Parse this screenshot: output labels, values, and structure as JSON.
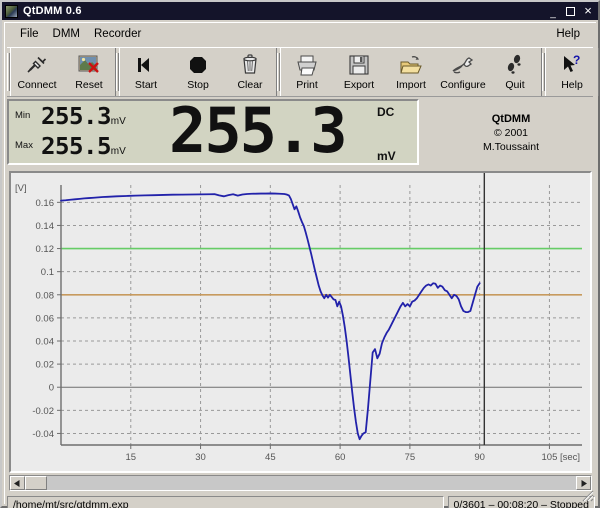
{
  "window": {
    "title": "QtDMM 0.6",
    "icon": "app-icon",
    "controls": {
      "minimize": "_",
      "maximize": "",
      "close": "×"
    }
  },
  "menubar": {
    "items": [
      {
        "label": "File",
        "name": "menu-file"
      },
      {
        "label": "DMM",
        "name": "menu-dmm"
      },
      {
        "label": "Recorder",
        "name": "menu-recorder"
      }
    ],
    "right": {
      "label": "Help",
      "name": "menu-help"
    }
  },
  "toolbar": {
    "groups": [
      {
        "buttons": [
          {
            "label": "Connect",
            "icon": "plug-icon"
          },
          {
            "label": "Reset",
            "icon": "reset-image-icon"
          }
        ]
      },
      {
        "buttons": [
          {
            "label": "Start",
            "icon": "start-arrow-icon"
          },
          {
            "label": "Stop",
            "icon": "stop-octagon-icon"
          },
          {
            "label": "Clear",
            "icon": "trash-icon"
          }
        ]
      },
      {
        "buttons": [
          {
            "label": "Print",
            "icon": "printer-icon"
          },
          {
            "label": "Export",
            "icon": "floppy-icon"
          },
          {
            "label": "Import",
            "icon": "open-folder-icon"
          },
          {
            "label": "Configure",
            "icon": "wrench-icon"
          },
          {
            "label": "Quit",
            "icon": "footprints-icon"
          }
        ]
      },
      {
        "buttons": [
          {
            "label": "Help",
            "icon": "help-arrow-icon"
          }
        ]
      }
    ]
  },
  "display": {
    "min_label": "Min",
    "min_value": "255.3",
    "min_unit": "mV",
    "max_label": "Max",
    "max_value": "255.5",
    "max_unit": "mV",
    "main_value": "255.3",
    "mode": "DC",
    "unit": "mV",
    "lcd_bg": "#d2d4c2"
  },
  "credits": {
    "name": "QtDMM",
    "copyright": "© 2001",
    "author": "M.Toussaint"
  },
  "chart_data": {
    "type": "line",
    "title": "",
    "xlabel": "[sec]",
    "ylabel": "[V]",
    "xlim": [
      0,
      112
    ],
    "ylim": [
      -0.05,
      0.175
    ],
    "xticks": [
      15,
      30,
      45,
      60,
      75,
      90,
      105
    ],
    "yticks": [
      -0.04,
      -0.02,
      0,
      0.02,
      0.04,
      0.06,
      0.08,
      0.1,
      0.12,
      0.14,
      0.16
    ],
    "ytick_labels": [
      "-0.04",
      "-0.02",
      "0",
      "0.02",
      "0.04",
      "0.06",
      "0.08",
      "0.1",
      "0.12",
      "0.14",
      "0.16"
    ],
    "xtick_labels": [
      "15",
      "30",
      "45",
      "60",
      "75",
      "90",
      "105"
    ],
    "grid": true,
    "legend": "none",
    "series": [
      {
        "name": "signal",
        "color": "#2222aa",
        "x": [
          0,
          1,
          2,
          3,
          4,
          5,
          6,
          7,
          8,
          9,
          10,
          12,
          14,
          16,
          18,
          20,
          22,
          24,
          26,
          28,
          30,
          32,
          33,
          34,
          35,
          36,
          37,
          38,
          39,
          40,
          41,
          42,
          43,
          44,
          45,
          46,
          47,
          48,
          48.5,
          49,
          49.4,
          49.8,
          50.2,
          50.6,
          51,
          51.4,
          51.8,
          52.2,
          52.6,
          53,
          53.4,
          53.8,
          54.2,
          54.6,
          55,
          55.4,
          55.8,
          56.2,
          56.6,
          57,
          57.4,
          57.8,
          58.2,
          58.6,
          59,
          59.4,
          59.8,
          60.2,
          60.6,
          61,
          61.4,
          61.8,
          62.2,
          62.6,
          63,
          63.4,
          63.8,
          64.2,
          64.6,
          65,
          65.5,
          66,
          66.5,
          67,
          67.5,
          68,
          68.5,
          69,
          69.5,
          70,
          70.5,
          71,
          71.5,
          72,
          72.5,
          73,
          73.5,
          74,
          74.5,
          75,
          75.5,
          76,
          76.5,
          77,
          77.5,
          78,
          78.5,
          79,
          79.5,
          80,
          80.5,
          81,
          81.5,
          82,
          82.5,
          83,
          83.5,
          84,
          84.5,
          85,
          85.5,
          86,
          86.5,
          87,
          87.5,
          88,
          88.5,
          89,
          89.5,
          90,
          90.5,
          91
        ],
        "y": [
          0.1615,
          0.1618,
          0.1622,
          0.1626,
          0.163,
          0.1634,
          0.1637,
          0.164,
          0.1643,
          0.1646,
          0.1648,
          0.1652,
          0.1655,
          0.1658,
          0.166,
          0.1662,
          0.1664,
          0.1666,
          0.1667,
          0.1668,
          0.1669,
          0.167,
          0.1671,
          0.166,
          0.1652,
          0.1662,
          0.167,
          0.1658,
          0.1668,
          0.1672,
          0.1674,
          0.1675,
          0.1676,
          0.1676,
          0.1677,
          0.1676,
          0.1674,
          0.1672,
          0.1668,
          0.166,
          0.163,
          0.1585,
          0.154,
          0.1565,
          0.152,
          0.147,
          0.143,
          0.1395,
          0.134,
          0.128,
          0.1215,
          0.115,
          0.108,
          0.101,
          0.0945,
          0.088,
          0.083,
          0.0795,
          0.077,
          0.08,
          0.0775,
          0.08,
          0.078,
          0.076,
          0.0755,
          0.07,
          0.074,
          0.07,
          0.062,
          0.052,
          0.04,
          0.026,
          0.011,
          -0.004,
          -0.018,
          -0.03,
          -0.04,
          -0.045,
          -0.042,
          -0.04,
          -0.039,
          -0.018,
          0.006,
          0.03,
          0.033,
          0.025,
          0.029,
          0.038,
          0.043,
          0.047,
          0.05,
          0.054,
          0.058,
          0.062,
          0.066,
          0.07,
          0.073,
          0.07,
          0.072,
          0.07,
          0.074,
          0.075,
          0.077,
          0.08,
          0.083,
          0.086,
          0.088,
          0.089,
          0.088,
          0.09,
          0.0895,
          0.086,
          0.088,
          0.087,
          0.084,
          0.083,
          0.08,
          0.077,
          0.08,
          0.079,
          0.076,
          0.07,
          0.066,
          0.065,
          0.065,
          0.066,
          0.073,
          0.08,
          0.087,
          0.09
        ]
      }
    ],
    "threshold_lines": [
      {
        "name": "upper-threshold",
        "value": 0.12,
        "color": "#66cc66"
      },
      {
        "name": "lower-threshold",
        "value": 0.08,
        "color": "#c79a5e"
      }
    ],
    "cursor_line": {
      "name": "cursor",
      "value": 91,
      "color": "#333333"
    }
  },
  "scrollbar": {
    "left_arrow": "◀",
    "right_arrow": "▶"
  },
  "statusbar": {
    "path": "/home/mt/src/qtdmm.exp",
    "info": "0/3601 – 00:08:20 – Stopped"
  }
}
